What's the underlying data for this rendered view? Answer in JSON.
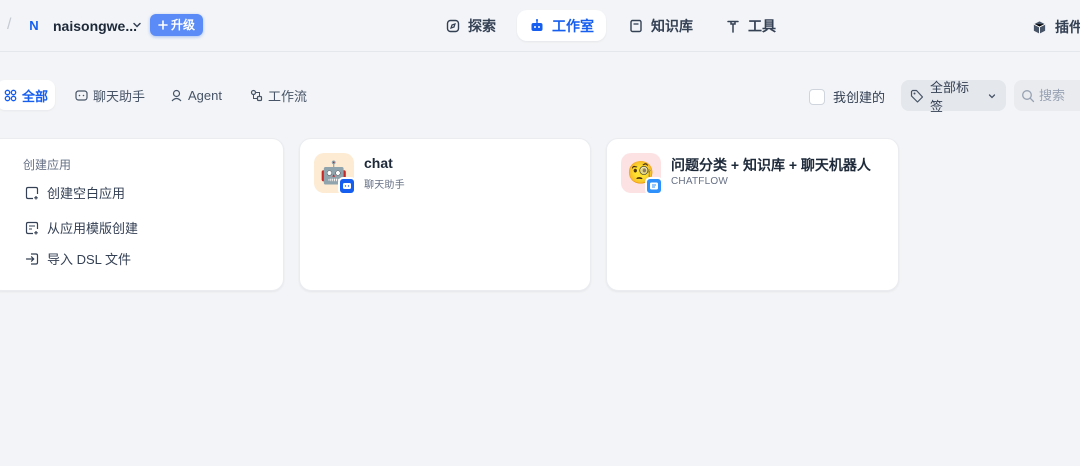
{
  "header": {
    "separator": "/",
    "workspace_initial": "N",
    "workspace_name": "naisongwe...",
    "upgrade_label": "升级",
    "nav": [
      {
        "label": "探索",
        "icon": "compass-icon"
      },
      {
        "label": "工作室",
        "icon": "robot-icon",
        "active": true
      },
      {
        "label": "知识库",
        "icon": "book-icon"
      },
      {
        "label": "工具",
        "icon": "hammer-icon"
      }
    ],
    "plugins_label": "插件"
  },
  "filters": {
    "tabs": [
      {
        "label": "全部",
        "icon": "grid-icon",
        "active": true
      },
      {
        "label": "聊天助手",
        "icon": "chat-icon"
      },
      {
        "label": "Agent",
        "icon": "agent-icon"
      },
      {
        "label": "工作流",
        "icon": "workflow-icon"
      }
    ],
    "created_by_me_label": "我创建的",
    "tags_label": "全部标签",
    "search_placeholder": "搜索"
  },
  "create_card": {
    "title": "创建应用",
    "items": [
      {
        "label": "创建空白应用",
        "icon": "file-plus-icon"
      },
      {
        "label": "从应用模版创建",
        "icon": "template-icon"
      },
      {
        "label": "导入 DSL 文件",
        "icon": "import-icon"
      }
    ]
  },
  "apps": [
    {
      "name": "chat",
      "type": "聊天助手",
      "emoji": "🤖",
      "icon_bg": "#fdebd3",
      "badge_color": "#155eef"
    },
    {
      "name": "问题分类 + 知识库 + 聊天机器人",
      "type": "CHATFLOW",
      "emoji": "🧐",
      "icon_bg": "#fde2e4",
      "badge_color": "#2e90fa"
    }
  ],
  "colors": {
    "accent": "#155eef",
    "upgrade": "#5a8bf6",
    "background": "#f2f4f7"
  }
}
